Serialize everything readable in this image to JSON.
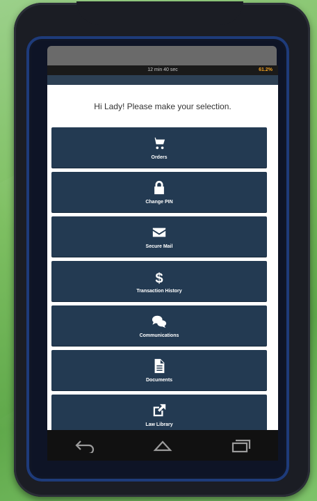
{
  "status_bar": {
    "center_text": "12 min 40 sec",
    "battery_text": "61.2%"
  },
  "greeting": "Hi Lady!  Please make your selection.",
  "menu": [
    {
      "label": "Orders",
      "icon": "cart-icon"
    },
    {
      "label": "Change PIN",
      "icon": "lock-icon"
    },
    {
      "label": "Secure Mail",
      "icon": "envelope-icon"
    },
    {
      "label": "Transaction History",
      "icon": "dollar-icon"
    },
    {
      "label": "Communications",
      "icon": "chat-bubbles-icon"
    },
    {
      "label": "Documents",
      "icon": "document-icon"
    },
    {
      "label": "Law Library",
      "icon": "external-link-icon"
    }
  ],
  "nav": [
    "back-icon",
    "home-icon",
    "recent-apps-icon"
  ]
}
